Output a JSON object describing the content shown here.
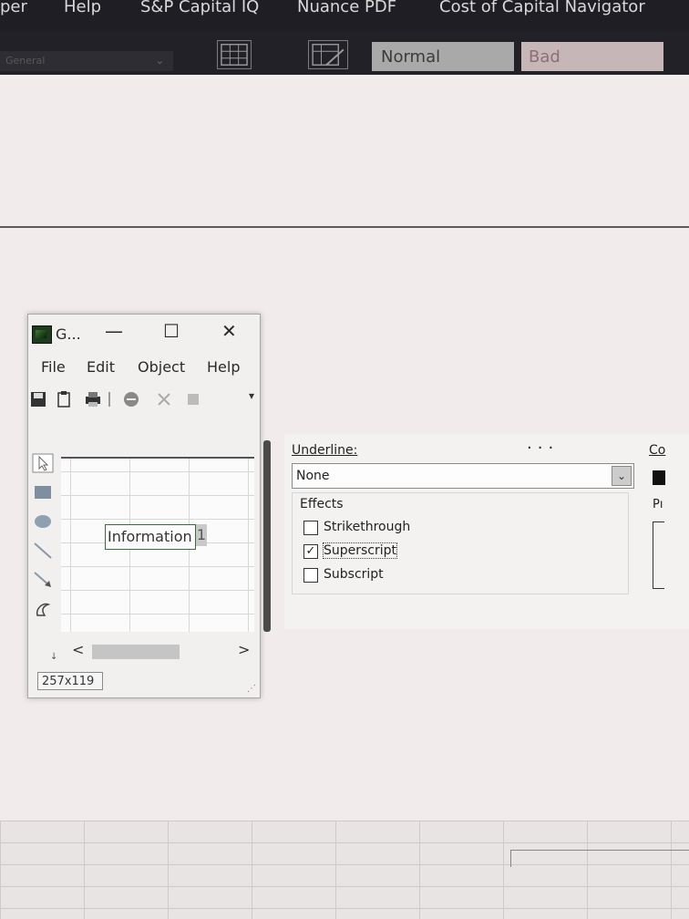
{
  "menubar": {
    "items": [
      "per",
      "Help",
      "S&P Capital IQ",
      "Nuance PDF",
      "Cost of Capital Navigator"
    ]
  },
  "ribbon": {
    "namebox": "General",
    "styles": {
      "normal": "Normal",
      "bad": "Bad"
    }
  },
  "graphic_window": {
    "title": "G...",
    "controls": {
      "minimize": "—",
      "maximize": "☐",
      "close": "✕"
    },
    "menu": [
      "File",
      "Edit",
      "Object",
      "Help"
    ],
    "canvas_text": "Information",
    "caret_text": "1",
    "scroll_left": "<",
    "scroll_right": ">",
    "scroll_marker": "↓",
    "status_size": "257x119"
  },
  "font_dialog": {
    "dots": "...",
    "underline_label": "Underline:",
    "underline_value": "None",
    "effects_label": "Effects",
    "effects": [
      {
        "label": "Strikethrough",
        "checked": false
      },
      {
        "label": "Superscript",
        "checked": true
      },
      {
        "label": "Subscript",
        "checked": false
      }
    ],
    "color_label": "Co",
    "preview_label": "Pı"
  },
  "colors": {
    "menubar_bg": "#1f1e24",
    "style_normal_bg": "#a9a9a9",
    "style_bad_bg": "#c7b6b8"
  }
}
